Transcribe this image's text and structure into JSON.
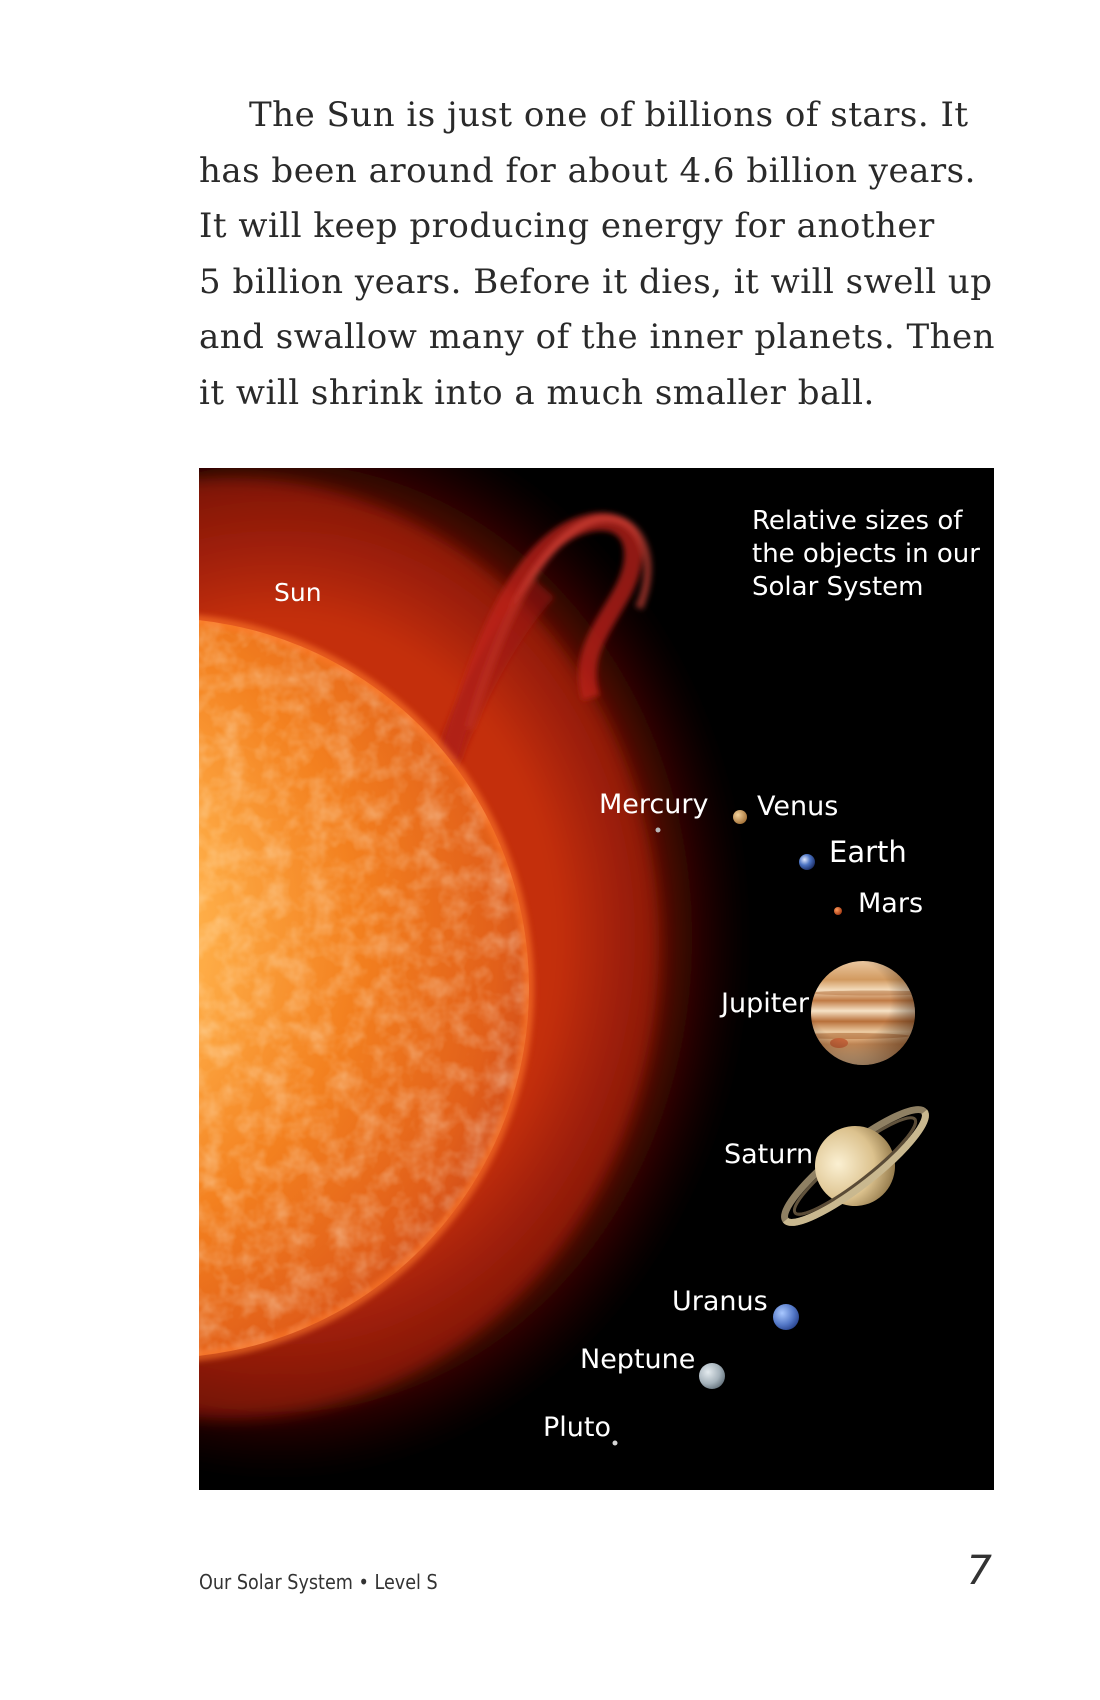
{
  "paragraph": {
    "lines": [
      "The Sun is just one of billions of stars. It",
      "has been around for about 4.6 billion years.",
      "It will keep producing energy for another",
      "5 billion years. Before it dies, it will swell up",
      "and swallow many of the inner planets. Then",
      "it will shrink into a much smaller ball."
    ]
  },
  "figure": {
    "caption_lines": [
      "Relative sizes of",
      "the objects in our",
      "Solar System"
    ],
    "labels": {
      "sun": "Sun",
      "mercury": "Mercury",
      "venus": "Venus",
      "earth": "Earth",
      "mars": "Mars",
      "jupiter": "Jupiter",
      "saturn": "Saturn",
      "uranus": "Uranus",
      "neptune": "Neptune",
      "pluto": "Pluto"
    }
  },
  "footer": {
    "book_title": "Our Solar System • Level S",
    "page_number": "7"
  }
}
